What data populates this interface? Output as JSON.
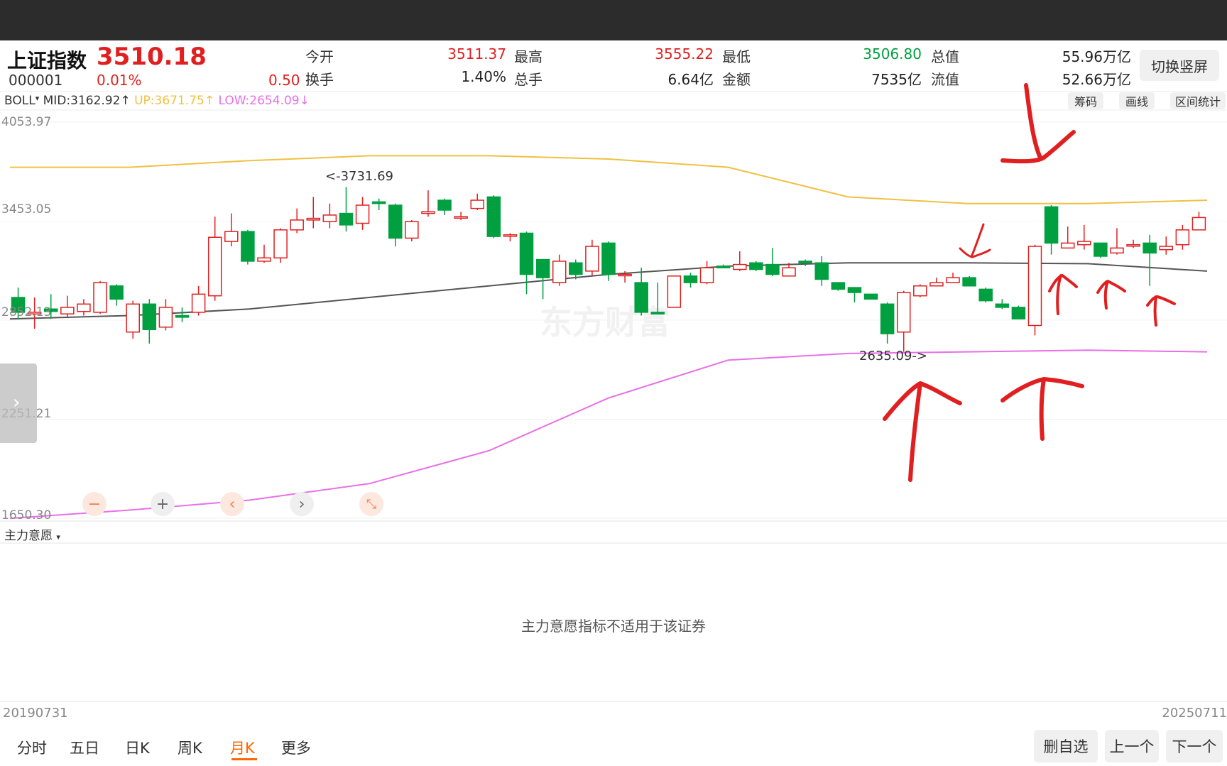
{
  "header": {
    "name": "上证指数",
    "price": "3510.18",
    "code": "000001",
    "pct": "0.01%",
    "change": "0.50",
    "open_label": "今开",
    "open_value": "3511.37",
    "high_label": "最高",
    "high_value": "3555.22",
    "low_label": "最低",
    "low_value": "3506.80",
    "cap_label": "总值",
    "cap_value": "55.96万亿",
    "turnover_label": "换手",
    "turnover_value": "1.40%",
    "vol_label": "总手",
    "vol_value": "6.64亿",
    "amt_label": "金额",
    "amt_value": "7535亿",
    "float_label": "流值",
    "float_value": "52.66万亿",
    "switch_label": "切换竖屏"
  },
  "indicator": {
    "boll": "BOLL",
    "mid": "MID:3162.92",
    "up": "UP:3671.75",
    "low": "LOW:2654.09",
    "up_arrow": "↑",
    "down_arrow": "↓",
    "chip_label": "筹码",
    "draw_label": "画线",
    "range_label": "区间统计"
  },
  "colors": {
    "up": "#e02020",
    "down": "#00a040",
    "mid": "#555555",
    "upper": "#f0c040",
    "lower": "#e870e8",
    "annot": "#e02020"
  },
  "chart_data": {
    "type": "candlestick",
    "ylim": [
      1650.3,
      4053.97
    ],
    "yticks": [
      {
        "value": 4053.97,
        "label": "4053.97"
      },
      {
        "value": 3453.05,
        "label": "3453.05"
      },
      {
        "value": 2852.13,
        "label": "2852.13"
      },
      {
        "value": 2251.21,
        "label": "2251.21"
      },
      {
        "value": 1650.3,
        "label": "1650.30"
      }
    ],
    "x_start_label": "20190731",
    "x_end_label": "20250711",
    "candles": [
      [
        2990,
        2900,
        3050,
        2860
      ],
      [
        2890,
        2900,
        2990,
        2800
      ],
      [
        2920,
        2905,
        3010,
        2860
      ],
      [
        2890,
        2930,
        3000,
        2870
      ],
      [
        2905,
        2950,
        2980,
        2880
      ],
      [
        2900,
        3080,
        3090,
        2890
      ],
      [
        3060,
        2980,
        3070,
        2940
      ],
      [
        2780,
        2950,
        2970,
        2740
      ],
      [
        2950,
        2795,
        2980,
        2710
      ],
      [
        2810,
        2930,
        2980,
        2790
      ],
      [
        2880,
        2870,
        2930,
        2840
      ],
      [
        2900,
        3010,
        3060,
        2880
      ],
      [
        3000,
        3355,
        3480,
        2970
      ],
      [
        3330,
        3390,
        3500,
        3300
      ],
      [
        3390,
        3210,
        3400,
        3190
      ],
      [
        3210,
        3230,
        3310,
        3200
      ],
      [
        3230,
        3400,
        3410,
        3200
      ],
      [
        3400,
        3460,
        3530,
        3380
      ],
      [
        3460,
        3470,
        3600,
        3410
      ],
      [
        3450,
        3490,
        3560,
        3410
      ],
      [
        3500,
        3430,
        3660,
        3390
      ],
      [
        3440,
        3550,
        3600,
        3400
      ],
      [
        3570,
        3560,
        3590,
        3520
      ],
      [
        3550,
        3350,
        3560,
        3300
      ],
      [
        3350,
        3450,
        3460,
        3330
      ],
      [
        3500,
        3510,
        3640,
        3480
      ],
      [
        3580,
        3520,
        3590,
        3490
      ],
      [
        3480,
        3480,
        3510,
        3460
      ],
      [
        3530,
        3580,
        3620,
        3520
      ],
      [
        3600,
        3360,
        3610,
        3350
      ],
      [
        3370,
        3370,
        3380,
        3330
      ],
      [
        3380,
        3130,
        3390,
        3010
      ],
      [
        3220,
        3110,
        3220,
        2980
      ],
      [
        3080,
        3210,
        3250,
        3060
      ],
      [
        3200,
        3130,
        3220,
        3100
      ],
      [
        3150,
        3300,
        3340,
        3120
      ],
      [
        3320,
        3130,
        3330,
        3090
      ],
      [
        3130,
        3130,
        3150,
        3080
      ],
      [
        3080,
        2900,
        3170,
        2880
      ],
      [
        2900,
        2890,
        3080,
        2890
      ],
      [
        2930,
        3120,
        3120,
        2930
      ],
      [
        3120,
        3080,
        3140,
        3050
      ],
      [
        3080,
        3170,
        3210,
        3070
      ],
      [
        3180,
        3170,
        3190,
        3170
      ],
      [
        3160,
        3190,
        3270,
        3150
      ],
      [
        3200,
        3160,
        3210,
        3150
      ],
      [
        3190,
        3130,
        3290,
        3120
      ],
      [
        3120,
        3170,
        3200,
        3120
      ],
      [
        3210,
        3200,
        3220,
        3180
      ],
      [
        3200,
        3100,
        3240,
        3060
      ],
      [
        3080,
        3040,
        3080,
        3030
      ],
      [
        3050,
        3020,
        3050,
        2960
      ],
      [
        3010,
        2980,
        3010,
        2980
      ],
      [
        2950,
        2770,
        2960,
        2710
      ],
      [
        2780,
        3020,
        3030,
        2660
      ],
      [
        3000,
        3060,
        3070,
        2990
      ],
      [
        3060,
        3080,
        3110,
        3060
      ],
      [
        3080,
        3110,
        3140,
        3080
      ],
      [
        3110,
        3060,
        3120,
        3060
      ],
      [
        3040,
        2970,
        3050,
        2960
      ],
      [
        2950,
        2930,
        2980,
        2920
      ],
      [
        2930,
        2860,
        2940,
        2860
      ],
      [
        2820,
        3300,
        3310,
        2760
      ],
      [
        3540,
        3320,
        3550,
        3250
      ],
      [
        3290,
        3320,
        3420,
        3290
      ],
      [
        3310,
        3330,
        3430,
        3280
      ],
      [
        3320,
        3240,
        3320,
        3230
      ],
      [
        3260,
        3290,
        3410,
        3250
      ],
      [
        3310,
        3310,
        3340,
        3290
      ],
      [
        3320,
        3260,
        3370,
        3060
      ],
      [
        3280,
        3300,
        3360,
        3250
      ],
      [
        3310,
        3400,
        3430,
        3280
      ],
      [
        3400,
        3475,
        3510,
        3400
      ]
    ],
    "boll_mid": [
      2860,
      2880,
      2920,
      2990,
      3060,
      3130,
      3180,
      3200,
      3200,
      3195,
      3150
    ],
    "boll_up": [
      3780,
      3780,
      3820,
      3850,
      3850,
      3830,
      3780,
      3600,
      3560,
      3560,
      3580
    ],
    "boll_low": [
      1650,
      1700,
      1760,
      1860,
      2060,
      2380,
      2610,
      2650,
      2660,
      2670,
      2660
    ],
    "annotations": {
      "high": "<-3731.69",
      "low": "2635.09->"
    }
  },
  "subpanel": {
    "label": "主力意愿",
    "caret": "▾",
    "message": "主力意愿指标不适用于该证券"
  },
  "tabs": [
    "分时",
    "五日",
    "日K",
    "周K",
    "月K",
    "更多"
  ],
  "active_tab": "月K",
  "buttons": {
    "remove_fav": "删自选",
    "prev": "上一个",
    "next": "下一个"
  },
  "watermark": "东方财富",
  "icons": [
    "zoom-out-icon",
    "zoom-in-icon",
    "back-icon",
    "forward-icon",
    "shrink-icon",
    "chevron-right-icon"
  ]
}
